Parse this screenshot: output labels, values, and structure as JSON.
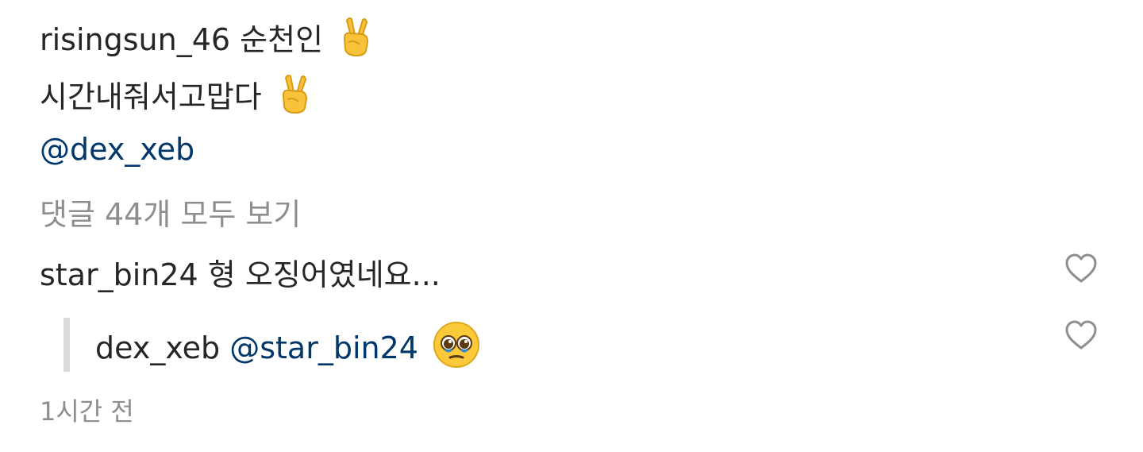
{
  "post": {
    "username": "risingsun_46",
    "caption_line1": "순천인",
    "caption_line2": "시간내줘서고맙다",
    "caption_emoji": "victory-hand-icon",
    "mention": "@dex_xeb"
  },
  "view_all_comments": "댓글 44개 모두 보기",
  "comments": [
    {
      "username": "star_bin24",
      "text": "형 오징어였네요..."
    }
  ],
  "reply": {
    "username": "dex_xeb",
    "mention": "@star_bin24",
    "emoji": "pleading-face-icon"
  },
  "timestamp": "1시간 전",
  "colors": {
    "text": "#262626",
    "mention": "#00376b",
    "muted": "#8e8e8e",
    "reply_bar": "#dbdbdb"
  }
}
